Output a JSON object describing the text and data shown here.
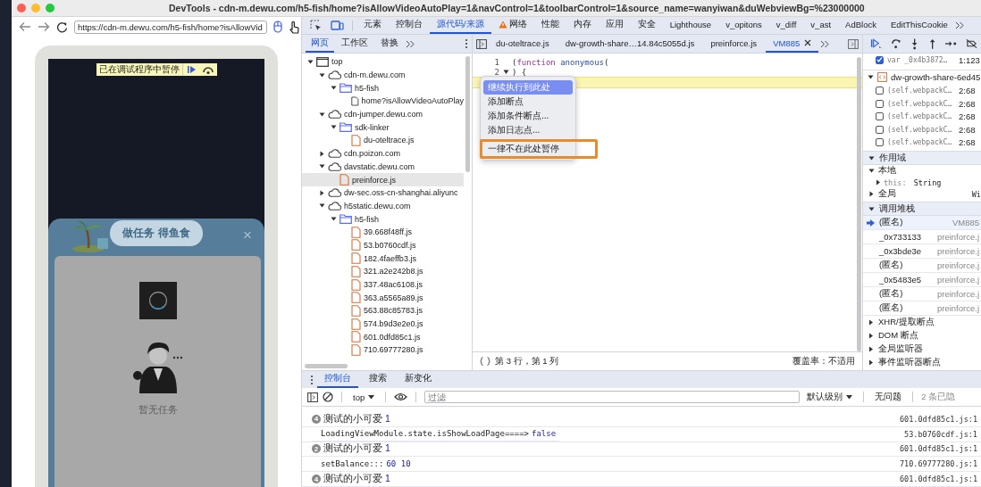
{
  "window": {
    "title": "DevTools - cdn-m.dewu.com/h5-fish/home?isAllowVideoAutoPlay=1&navControl=1&toolbarControl=1&source_name=wanyiwan&duWebviewBg=%23000000"
  },
  "device_toolbar": {
    "url": "https://cdn-m.dewu.com/h5-fish/home?isAllowVid"
  },
  "page": {
    "paused_banner": "已在调试程序中暂停",
    "dialog_title": "做任务 得鱼食",
    "close": "×",
    "empty_text": "暂无任务"
  },
  "panel_tabs": [
    {
      "label": "元素",
      "selected": false,
      "warning": false
    },
    {
      "label": "控制台",
      "selected": false,
      "warning": false
    },
    {
      "label": "源代码/来源",
      "selected": true,
      "warning": false
    },
    {
      "label": "网络",
      "selected": false,
      "warning": true
    },
    {
      "label": "性能",
      "selected": false,
      "warning": false
    },
    {
      "label": "内存",
      "selected": false,
      "warning": false
    },
    {
      "label": "应用",
      "selected": false,
      "warning": false
    },
    {
      "label": "安全",
      "selected": false,
      "warning": false
    },
    {
      "label": "Lighthouse",
      "selected": false,
      "warning": false
    },
    {
      "label": "v_opitons",
      "selected": false,
      "warning": false
    },
    {
      "label": "v_diff",
      "selected": false,
      "warning": false
    },
    {
      "label": "v_ast",
      "selected": false,
      "warning": false
    },
    {
      "label": "AdBlock",
      "selected": false,
      "warning": false
    },
    {
      "label": "EditThisCookie",
      "selected": false,
      "warning": false
    }
  ],
  "navigator_tabs": [
    {
      "label": "网页",
      "selected": true
    },
    {
      "label": "工作区",
      "selected": false
    },
    {
      "label": "替换",
      "selected": false
    }
  ],
  "tree": [
    {
      "label": "top",
      "kind": "frame",
      "expanded": true,
      "selected": false,
      "children": [
        {
          "label": "cdn-m.dewu.com",
          "kind": "domain",
          "expanded": true,
          "selected": false,
          "children": [
            {
              "label": "h5-fish",
              "kind": "folder",
              "expanded": true,
              "selected": false,
              "children": [
                {
                  "label": "home?isAllowVideoAutoPlay",
                  "kind": "document",
                  "selected": false
                }
              ]
            }
          ]
        },
        {
          "label": "cdn-jumper.dewu.com",
          "kind": "domain",
          "expanded": true,
          "selected": false,
          "children": [
            {
              "label": "sdk-linker",
              "kind": "folder",
              "expanded": true,
              "selected": false,
              "children": [
                {
                  "label": "du-oteltrace.js",
                  "kind": "script",
                  "selected": false
                }
              ]
            }
          ]
        },
        {
          "label": "cdn.poizon.com",
          "kind": "domain",
          "expanded": false,
          "selected": false
        },
        {
          "label": "davstatic.dewu.com",
          "kind": "domain",
          "expanded": true,
          "selected": false,
          "children": [
            {
              "label": "preinforce.js",
              "kind": "script",
              "selected": true
            }
          ]
        },
        {
          "label": "dw-sec.oss-cn-shanghai.aliyunc",
          "kind": "domain",
          "expanded": false,
          "selected": false
        },
        {
          "label": "h5static.dewu.com",
          "kind": "domain",
          "expanded": true,
          "selected": false,
          "children": [
            {
              "label": "h5-fish",
              "kind": "folder",
              "expanded": true,
              "selected": false,
              "children": [
                {
                  "label": "39.668f48ff.js",
                  "kind": "script",
                  "selected": false
                },
                {
                  "label": "53.b0760cdf.js",
                  "kind": "script",
                  "selected": false
                },
                {
                  "label": "182.4faeffb3.js",
                  "kind": "script",
                  "selected": false
                },
                {
                  "label": "321.a2e242b8.js",
                  "kind": "script",
                  "selected": false
                },
                {
                  "label": "337.48ac6108.js",
                  "kind": "script",
                  "selected": false
                },
                {
                  "label": "363.a5565a89.js",
                  "kind": "script",
                  "selected": false
                },
                {
                  "label": "563.88c85783.js",
                  "kind": "script",
                  "selected": false
                },
                {
                  "label": "574.b9d3e2e0.js",
                  "kind": "script",
                  "selected": false
                },
                {
                  "label": "601.0dfd85c1.js",
                  "kind": "script",
                  "selected": false
                },
                {
                  "label": "710.69777280.js",
                  "kind": "script",
                  "selected": false
                }
              ]
            }
          ]
        }
      ]
    }
  ],
  "file_tabs": [
    {
      "label": "du-oteltrace.js",
      "selected": false
    },
    {
      "label": "dw-growth-share…14.84c5055d.js",
      "selected": false
    },
    {
      "label": "preinforce.js",
      "selected": false
    },
    {
      "label": "VM885",
      "selected": true
    }
  ],
  "editor": {
    "lines": [
      {
        "number": "1",
        "current": false,
        "foldable": false,
        "tokens": [
          {
            "text": "(",
            "kind": "punct"
          },
          {
            "text": "function",
            "kind": "keyword"
          },
          {
            "text": " anonymous",
            "kind": "def"
          },
          {
            "text": "(",
            "kind": "punct"
          }
        ]
      },
      {
        "number": "2",
        "current": false,
        "foldable": true,
        "tokens": [
          {
            "text": ") {",
            "kind": "punct"
          }
        ]
      },
      {
        "current": true,
        "foldable": false
      }
    ]
  },
  "context_menu": [
    {
      "label": "继续执行到此处",
      "selected": true,
      "annotated": false
    },
    {
      "label": "添加断点",
      "selected": false,
      "annotated": false
    },
    {
      "label": "添加条件断点...",
      "selected": false,
      "annotated": false
    },
    {
      "label": "添加日志点...",
      "selected": false,
      "annotated": false
    },
    {
      "label": "一律不在此处暂停",
      "selected": false,
      "annotated": true
    }
  ],
  "status_bar": {
    "position": "第 3 行，第 1 列",
    "coverage": "覆盖率：不适用"
  },
  "breakpoints": [
    {
      "code": "var _0x4b3872…",
      "location": "1:123",
      "checked": true
    }
  ],
  "breakpoint_group": {
    "file": "dw-growth-share-6ed45",
    "expanded": true,
    "items": [
      {
        "code": "(self.webpackC…",
        "location": "2:68",
        "checked": false
      },
      {
        "code": "(self.webpackC…",
        "location": "2:68",
        "checked": false
      },
      {
        "code": "(self.webpackC…",
        "location": "2:68",
        "checked": false
      },
      {
        "code": "(self.webpackC…",
        "location": "2:68",
        "checked": false
      },
      {
        "code": "(self.webpackC…",
        "location": "2:68",
        "checked": false
      }
    ]
  },
  "scope": {
    "title": "作用域",
    "expanded": true,
    "local": {
      "label": "本地",
      "expanded": true,
      "entries": [
        {
          "name": "this:",
          "value": "String",
          "expanded": false
        }
      ]
    },
    "global": {
      "label": "全局",
      "value": "Wi",
      "expanded": false
    }
  },
  "call_stack": {
    "title": "调用堆栈",
    "expanded": true,
    "frames": [
      {
        "name": "(匿名)",
        "location": "VM885",
        "selected": true
      },
      {
        "name": "_0x733133",
        "location": "preinforce.j",
        "selected": false
      },
      {
        "name": "_0x3bde3e",
        "location": "preinforce.j",
        "selected": false
      },
      {
        "name": "(匿名)",
        "location": "preinforce.j",
        "selected": false
      },
      {
        "name": "_0x5483e5",
        "location": "preinforce.j",
        "selected": false
      },
      {
        "name": "(匿名)",
        "location": "preinforce.j",
        "selected": false
      },
      {
        "name": "(匿名)",
        "location": "preinforce.j",
        "selected": false
      }
    ]
  },
  "sections": [
    {
      "label": "XHR/提取断点",
      "expanded": false
    },
    {
      "label": "DOM 断点",
      "expanded": false
    },
    {
      "label": "全局监听器",
      "expanded": false
    },
    {
      "label": "事件监听器断点",
      "expanded": false
    }
  ],
  "drawer": {
    "tabs": [
      {
        "label": "控制台",
        "selected": true
      },
      {
        "label": "搜索",
        "selected": false
      },
      {
        "label": "新变化",
        "selected": false
      }
    ],
    "context": "top",
    "filter_placeholder": "过滤",
    "level": "默认级别",
    "issues": "无问题",
    "hidden": "2 条已隐"
  },
  "console": [
    {
      "kind": "repeat",
      "count": "4",
      "text": "测试的小可爱",
      "value": "1",
      "source": "601.0dfd85c1.js:1"
    },
    {
      "kind": "log",
      "text": "LoadingViewModule.state.isShowLoadPage====>",
      "value": "false",
      "source": "53.b0760cdf.js:1"
    },
    {
      "kind": "repeat",
      "count": "2",
      "text": "测试的小可爱",
      "value": "1",
      "source": "601.0dfd85c1.js:1"
    },
    {
      "kind": "log",
      "text": "setBalance:::",
      "value": "60 10",
      "source": "710.69777280.js:1"
    },
    {
      "kind": "repeat",
      "count": "4",
      "text": "测试的小可爱",
      "value": "1",
      "source": "601.0dfd85c1.js:1"
    }
  ]
}
